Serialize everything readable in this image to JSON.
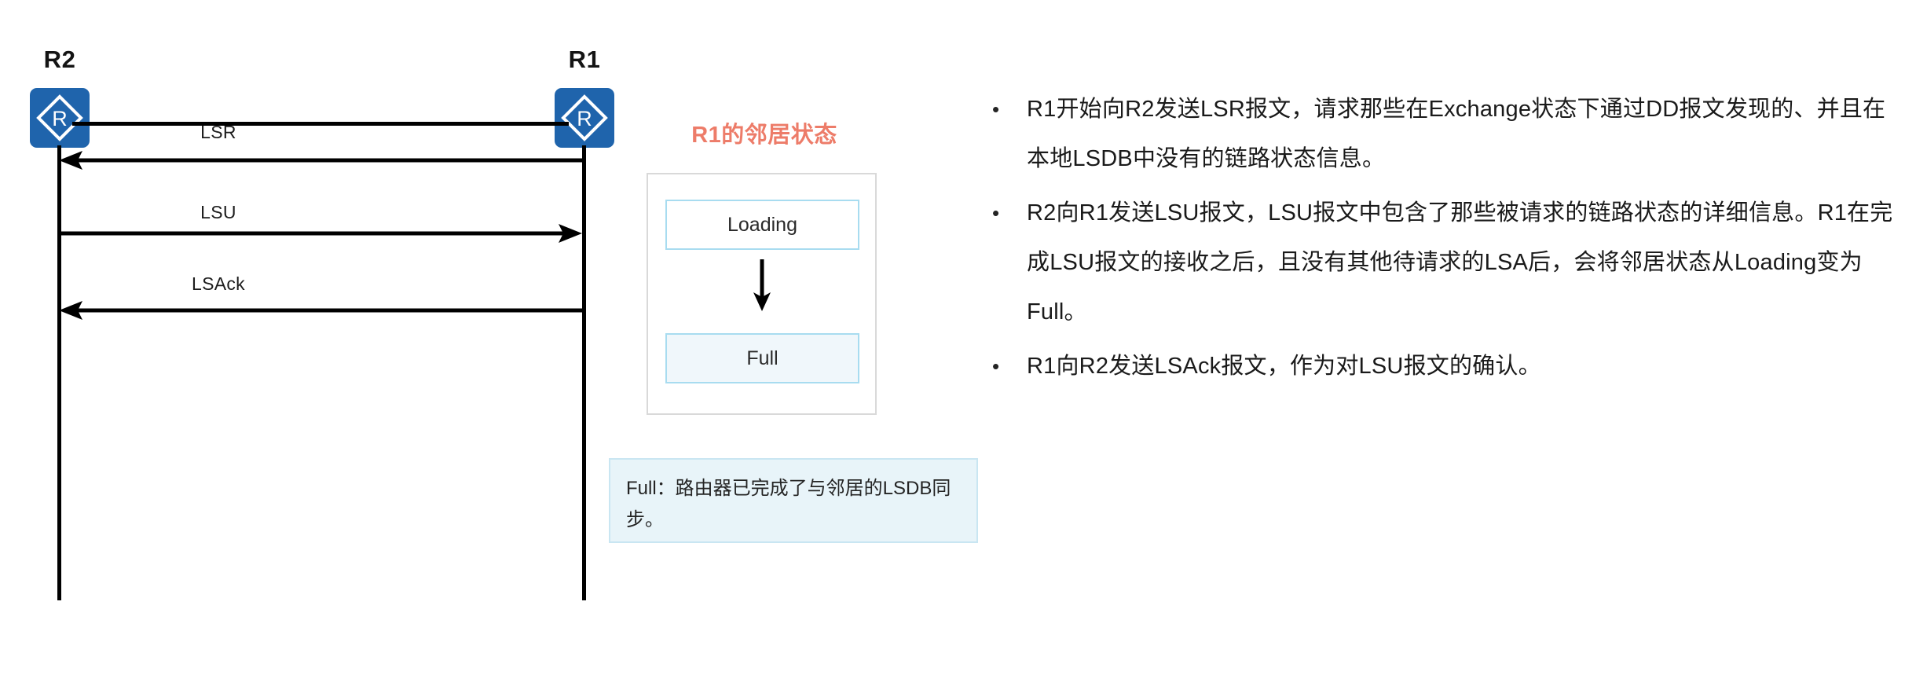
{
  "diagram": {
    "nodes": [
      {
        "id": "r2",
        "label": "R2",
        "icon": "router-icon"
      },
      {
        "id": "r1",
        "label": "R1",
        "icon": "router-icon"
      }
    ],
    "messages": [
      {
        "label": "LSR",
        "direction": "right-to-left",
        "from": "R1",
        "to": "R2"
      },
      {
        "label": "LSU",
        "direction": "left-to-right",
        "from": "R2",
        "to": "R1"
      },
      {
        "label": "LSAck",
        "direction": "right-to-left",
        "from": "R1",
        "to": "R2"
      }
    ]
  },
  "state_panel": {
    "title": "R1的邻居状态",
    "title_color": "#ED7C69",
    "states": [
      {
        "label": "Loading",
        "active": false
      },
      {
        "label": "Full",
        "active": true
      }
    ],
    "transition_icon": "down-arrow-icon",
    "note": "Full：路由器已完成了与邻居的LSDB同步。"
  },
  "explanation": {
    "bullet_marker": "•",
    "bullets": [
      "R1开始向R2发送LSR报文，请求那些在Exchange状态下通过DD报文发现的、并且在本地LSDB中没有的链路状态信息。",
      "R2向R1发送LSU报文，LSU报文中包含了那些被请求的链路状态的详细信息。R1在完成LSU报文的接收之后，且没有其他待请求的LSA后，会将邻居状态从Loading变为Full。",
      "R1向R2发送LSAck报文，作为对LSU报文的确认。"
    ]
  },
  "colors": {
    "router_blue": "#1F64AC",
    "accent_salmon": "#ED7C69",
    "state_border_blue": "#A8DCF0",
    "note_fill": "#E8F4F9",
    "line_black": "#000000"
  }
}
